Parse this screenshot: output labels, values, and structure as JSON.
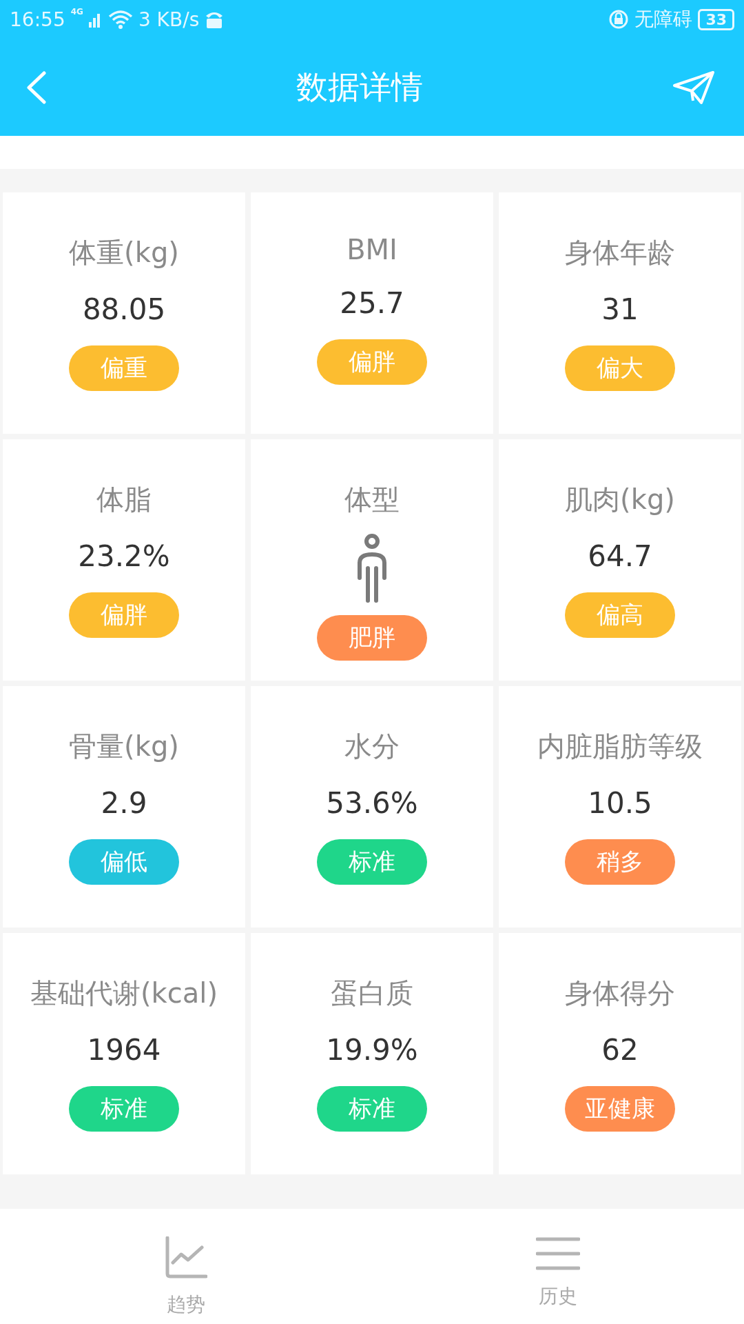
{
  "status_bar": {
    "time": "16:55",
    "network": "4G",
    "speed": "3 KB/s",
    "accessibility": "无障碍",
    "battery": "33"
  },
  "header": {
    "title": "数据详情"
  },
  "metrics": [
    {
      "kind": "value",
      "label": "体重(kg)",
      "value": "88.05",
      "status": "偏重",
      "color": "#fcbd30"
    },
    {
      "kind": "value",
      "label": "BMI",
      "value": "25.7",
      "status": "偏胖",
      "color": "#fcbd30"
    },
    {
      "kind": "value",
      "label": "身体年龄",
      "value": "31",
      "status": "偏大",
      "color": "#fcbd30"
    },
    {
      "kind": "value",
      "label": "体脂",
      "value": "23.2%",
      "status": "偏胖",
      "color": "#fcbd30"
    },
    {
      "kind": "figure",
      "label": "体型",
      "status": "肥胖",
      "color": "#fe8d4f"
    },
    {
      "kind": "value",
      "label": "肌肉(kg)",
      "value": "64.7",
      "status": "偏高",
      "color": "#fcbd30"
    },
    {
      "kind": "value",
      "label": "骨量(kg)",
      "value": "2.9",
      "status": "偏低",
      "color": "#22c4dc"
    },
    {
      "kind": "value",
      "label": "水分",
      "value": "53.6%",
      "status": "标准",
      "color": "#1fd68a"
    },
    {
      "kind": "value",
      "label": "内脏脂肪等级",
      "value": "10.5",
      "status": "稍多",
      "color": "#fe8d4f"
    },
    {
      "kind": "value",
      "label": "基础代谢(kcal)",
      "value": "1964",
      "status": "标准",
      "color": "#1fd68a"
    },
    {
      "kind": "value",
      "label": "蛋白质",
      "value": "19.9%",
      "status": "标准",
      "color": "#1fd68a"
    },
    {
      "kind": "value",
      "label": "身体得分",
      "value": "62",
      "status": "亚健康",
      "color": "#fe8d4f"
    }
  ],
  "bottom_nav": [
    {
      "label": "趋势",
      "kind": "chart"
    },
    {
      "label": "历史",
      "kind": "list"
    }
  ]
}
